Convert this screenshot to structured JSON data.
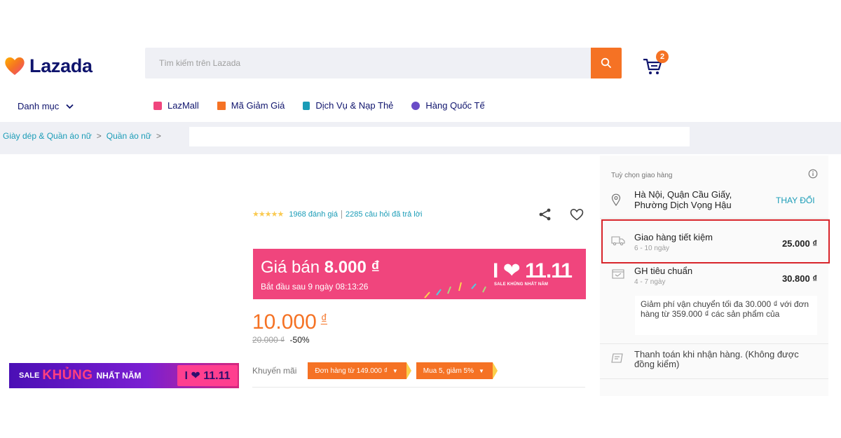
{
  "header": {
    "logo_text": "Lazada",
    "search_placeholder": "Tìm kiếm trên Lazada",
    "cart_count": "2"
  },
  "nav": {
    "category_label": "Danh mục",
    "links": [
      {
        "label": "LazMall",
        "icon": "lazmall-icon",
        "color": "#f0457d"
      },
      {
        "label": "Mã Giảm Giá",
        "icon": "coupon-icon",
        "color": "#f57224"
      },
      {
        "label": "Dịch Vụ & Nạp Thẻ",
        "icon": "phone-topup-icon",
        "color": "#1a9cb7"
      },
      {
        "label": "Hàng Quốc Tế",
        "icon": "global-goods-icon",
        "color": "#6a4cc7"
      }
    ]
  },
  "breadcrumb": {
    "items": [
      "Giày dép & Quần áo nữ",
      "Quần áo nữ"
    ],
    "separator": ">"
  },
  "product": {
    "sale_banner": {
      "sale": "SALE",
      "khung": "KHỦNG",
      "nhat_nam": "NHẤT NĂM",
      "tag": "I ❤ 11.11"
    },
    "rating": {
      "stars": "★★★★★",
      "reviews": "1968 đánh giá",
      "answers": "2285 câu hỏi đã trả lời"
    },
    "flash_sale": {
      "label": "Giá bán",
      "price": "8.000 ₫",
      "countdown": "Bắt đầu sau 9 ngày 08:13:26",
      "logo": "I ❤ 11.11",
      "logo_sub": "SALE KHỦNG NHẤT NĂM"
    },
    "price": "10.000",
    "currency": "₫",
    "original_price": "20.000 ₫",
    "discount": "-50%",
    "promotions": {
      "label": "Khuyến mãi",
      "vouchers": [
        "Đơn hàng từ 149.000 ₫",
        "Mua 5, giảm 5%"
      ]
    }
  },
  "delivery": {
    "title": "Tuỳ chọn giao hàng",
    "address": "Hà Nội, Quận Cầu Giấy, Phường Dịch Vọng Hậu",
    "change_label": "THAY ĐỔI",
    "options": [
      {
        "name": "Giao hàng tiết kiệm",
        "days": "6 - 10 ngày",
        "price": "25.000 ₫"
      },
      {
        "name": "GH tiêu chuẩn",
        "days": "4 - 7 ngày",
        "price": "30.800 ₫"
      }
    ],
    "note": "Giảm phí vận chuyển tối đa 30.000 ₫ với đơn hàng từ 359.000 ₫ các sản phẩm của",
    "cod": "Thanh toán khi nhận hàng. (Không được đồng kiểm)"
  },
  "colors": {
    "accent": "#f57224",
    "link": "#1a9cb7",
    "brand_navy": "#0f146d",
    "flash_pink": "#f0457d",
    "highlight_red": "#d8252b"
  }
}
